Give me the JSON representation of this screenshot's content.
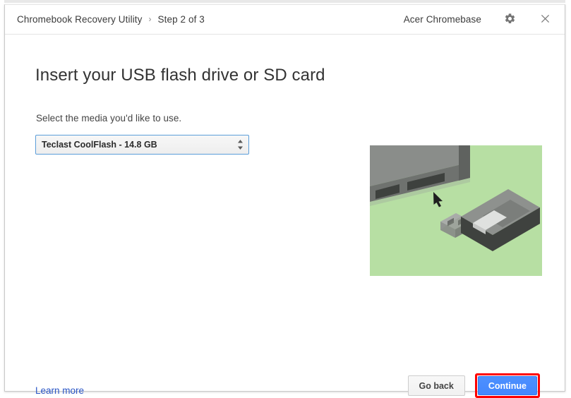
{
  "window": {
    "header": {
      "breadcrumb": {
        "app_name": "Chromebook Recovery Utility",
        "separator": "›",
        "step": "Step 2 of 3"
      },
      "device_name": "Acer Chromebase",
      "settings_icon": "gear-icon",
      "close_icon": "close-icon"
    },
    "main": {
      "title": "Insert your USB flash drive or SD card",
      "media_label": "Select the media you'd like to use.",
      "media_select": {
        "selected_value": "Teclast CoolFlash - 14.8 GB",
        "options": [
          "Teclast CoolFlash - 14.8 GB"
        ],
        "spinner_icon": "updown-spinner-icon",
        "focus_border_color": "#5b9dd9"
      },
      "illustration": {
        "name": "usb-insertion-illustration",
        "background_color": "#b7dfa3",
        "device_top_color": "#888b88",
        "device_front_color": "#6b6e6b",
        "port_color": "#3c3f3c",
        "usb_body_color": "#8e918e",
        "usb_side_color": "#3c3f3c",
        "usb_label_color": "#dcdedc",
        "arrow_color": "#1a1a1a"
      }
    },
    "footer": {
      "learn_more": "Learn more",
      "learn_more_color": "#2a56c6",
      "go_back": "Go back",
      "continue": "Continue",
      "continue_color": "#4285f4",
      "highlight_color": "#ff0000"
    }
  }
}
